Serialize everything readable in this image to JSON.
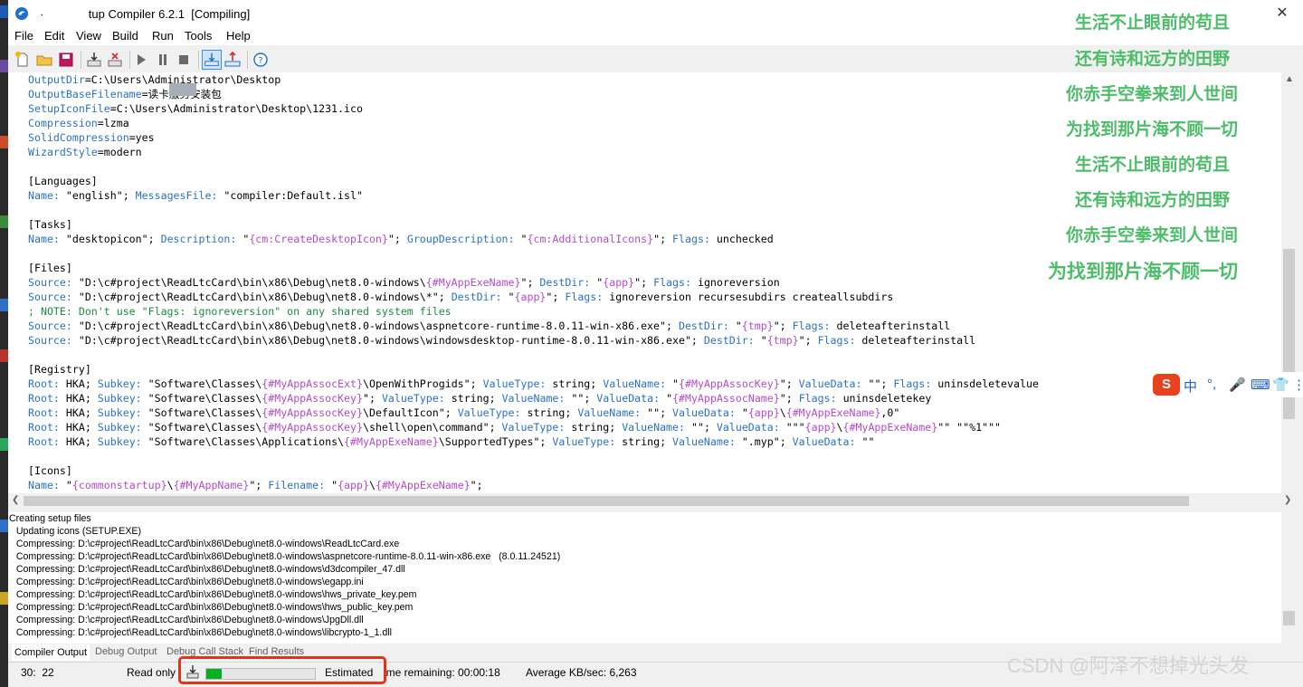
{
  "window": {
    "title": "- Inno Setup Compiler 6.2.1  [Compiling]",
    "close_glyph": "✕"
  },
  "menu": [
    "File",
    "Edit",
    "View",
    "Build",
    "Run",
    "Tools",
    "Help"
  ],
  "editor": {
    "lines": [
      [
        {
          "t": "OutputDir",
          "k": "k"
        },
        {
          "t": "=C:\\Users\\Administrator\\Desktop"
        }
      ],
      [
        {
          "t": "OutputBaseFilename",
          "k": "k"
        },
        {
          "t": "="
        },
        {
          "t": "读卡服务安装包"
        }
      ],
      [
        {
          "t": "SetupIconFile",
          "k": "k"
        },
        {
          "t": "=C:\\Users\\Administrator\\Desktop\\1231.ico"
        }
      ],
      [
        {
          "t": "Compression",
          "k": "k"
        },
        {
          "t": "=lzma"
        }
      ],
      [
        {
          "t": "SolidCompression",
          "k": "k"
        },
        {
          "t": "=yes"
        }
      ],
      [
        {
          "t": "WizardStyle",
          "k": "k"
        },
        {
          "t": "=modern"
        }
      ],
      [],
      [
        {
          "t": "[Languages]"
        }
      ],
      [
        {
          "t": "Name:",
          "k": "k"
        },
        {
          "t": " \"english\"; "
        },
        {
          "t": "MessagesFile:",
          "k": "k"
        },
        {
          "t": " \"compiler:Default.isl\""
        }
      ],
      [],
      [
        {
          "t": "[Tasks]"
        }
      ],
      [
        {
          "t": "Name:",
          "k": "k"
        },
        {
          "t": " \"desktopicon\"; "
        },
        {
          "t": "Description:",
          "k": "k"
        },
        {
          "t": " \""
        },
        {
          "t": "{cm:CreateDesktopIcon}",
          "k": "m"
        },
        {
          "t": "\"; "
        },
        {
          "t": "GroupDescription:",
          "k": "k"
        },
        {
          "t": " \""
        },
        {
          "t": "{cm:AdditionalIcons}",
          "k": "m"
        },
        {
          "t": "\"; "
        },
        {
          "t": "Flags:",
          "k": "k"
        },
        {
          "t": " unchecked"
        }
      ],
      [],
      [
        {
          "t": "[Files]"
        }
      ],
      [
        {
          "t": "Source:",
          "k": "k"
        },
        {
          "t": " \"D:\\c#project\\ReadLtcCard\\bin\\x86\\Debug\\net8.0-windows\\"
        },
        {
          "t": "{#MyAppExeName}",
          "k": "m"
        },
        {
          "t": "\"; "
        },
        {
          "t": "DestDir:",
          "k": "k"
        },
        {
          "t": " \""
        },
        {
          "t": "{app}",
          "k": "m"
        },
        {
          "t": "\"; "
        },
        {
          "t": "Flags:",
          "k": "k"
        },
        {
          "t": " ignoreversion"
        }
      ],
      [
        {
          "t": "Source:",
          "k": "k"
        },
        {
          "t": " \"D:\\c#project\\ReadLtcCard\\bin\\x86\\Debug\\net8.0-windows\\*\"; "
        },
        {
          "t": "DestDir:",
          "k": "k"
        },
        {
          "t": " \""
        },
        {
          "t": "{app}",
          "k": "m"
        },
        {
          "t": "\"; "
        },
        {
          "t": "Flags:",
          "k": "k"
        },
        {
          "t": " ignoreversion recursesubdirs createallsubdirs"
        }
      ],
      [
        {
          "t": "; NOTE: Don't use \"Flags: ignoreversion\" on any shared system files",
          "k": "c"
        }
      ],
      [
        {
          "t": "Source:",
          "k": "k"
        },
        {
          "t": " \"D:\\c#project\\ReadLtcCard\\bin\\x86\\Debug\\net8.0-windows\\aspnetcore-runtime-8.0.11-win-x86.exe\"; "
        },
        {
          "t": "DestDir:",
          "k": "k"
        },
        {
          "t": " \""
        },
        {
          "t": "{tmp}",
          "k": "m"
        },
        {
          "t": "\"; "
        },
        {
          "t": "Flags:",
          "k": "k"
        },
        {
          "t": " deleteafterinstall"
        }
      ],
      [
        {
          "t": "Source:",
          "k": "k"
        },
        {
          "t": " \"D:\\c#project\\ReadLtcCard\\bin\\x86\\Debug\\net8.0-windows\\windowsdesktop-runtime-8.0.11-win-x86.exe\"; "
        },
        {
          "t": "DestDir:",
          "k": "k"
        },
        {
          "t": " \""
        },
        {
          "t": "{tmp}",
          "k": "m"
        },
        {
          "t": "\"; "
        },
        {
          "t": "Flags:",
          "k": "k"
        },
        {
          "t": " deleteafterinstall"
        }
      ],
      [],
      [
        {
          "t": "[Registry]"
        }
      ],
      [
        {
          "t": "Root:",
          "k": "k"
        },
        {
          "t": " HKA; "
        },
        {
          "t": "Subkey:",
          "k": "k"
        },
        {
          "t": " \"Software\\Classes\\"
        },
        {
          "t": "{#MyAppAssocExt}",
          "k": "m"
        },
        {
          "t": "\\OpenWithProgids\"; "
        },
        {
          "t": "ValueType:",
          "k": "k"
        },
        {
          "t": " string; "
        },
        {
          "t": "ValueName:",
          "k": "k"
        },
        {
          "t": " \""
        },
        {
          "t": "{#MyAppAssocKey}",
          "k": "m"
        },
        {
          "t": "\"; "
        },
        {
          "t": "ValueData:",
          "k": "k"
        },
        {
          "t": " \"\"; "
        },
        {
          "t": "Flags:",
          "k": "k"
        },
        {
          "t": " uninsdeletevalue"
        }
      ],
      [
        {
          "t": "Root:",
          "k": "k"
        },
        {
          "t": " HKA; "
        },
        {
          "t": "Subkey:",
          "k": "k"
        },
        {
          "t": " \"Software\\Classes\\"
        },
        {
          "t": "{#MyAppAssocKey}",
          "k": "m"
        },
        {
          "t": "\"; "
        },
        {
          "t": "ValueType:",
          "k": "k"
        },
        {
          "t": " string; "
        },
        {
          "t": "ValueName:",
          "k": "k"
        },
        {
          "t": " \"\"; "
        },
        {
          "t": "ValueData:",
          "k": "k"
        },
        {
          "t": " \""
        },
        {
          "t": "{#MyAppAssocName}",
          "k": "m"
        },
        {
          "t": "\"; "
        },
        {
          "t": "Flags:",
          "k": "k"
        },
        {
          "t": " uninsdeletekey"
        }
      ],
      [
        {
          "t": "Root:",
          "k": "k"
        },
        {
          "t": " HKA; "
        },
        {
          "t": "Subkey:",
          "k": "k"
        },
        {
          "t": " \"Software\\Classes\\"
        },
        {
          "t": "{#MyAppAssocKey}",
          "k": "m"
        },
        {
          "t": "\\DefaultIcon\"; "
        },
        {
          "t": "ValueType:",
          "k": "k"
        },
        {
          "t": " string; "
        },
        {
          "t": "ValueName:",
          "k": "k"
        },
        {
          "t": " \"\"; "
        },
        {
          "t": "ValueData:",
          "k": "k"
        },
        {
          "t": " \""
        },
        {
          "t": "{app}",
          "k": "m"
        },
        {
          "t": "\\"
        },
        {
          "t": "{#MyAppExeName}",
          "k": "m"
        },
        {
          "t": ",0\""
        }
      ],
      [
        {
          "t": "Root:",
          "k": "k"
        },
        {
          "t": " HKA; "
        },
        {
          "t": "Subkey:",
          "k": "k"
        },
        {
          "t": " \"Software\\Classes\\"
        },
        {
          "t": "{#MyAppAssocKey}",
          "k": "m"
        },
        {
          "t": "\\shell\\open\\command\"; "
        },
        {
          "t": "ValueType:",
          "k": "k"
        },
        {
          "t": " string; "
        },
        {
          "t": "ValueName:",
          "k": "k"
        },
        {
          "t": " \"\"; "
        },
        {
          "t": "ValueData:",
          "k": "k"
        },
        {
          "t": " \"\"\""
        },
        {
          "t": "{app}",
          "k": "m"
        },
        {
          "t": "\\"
        },
        {
          "t": "{#MyAppExeName}",
          "k": "m"
        },
        {
          "t": "\"\" \"\"%1\"\"\""
        }
      ],
      [
        {
          "t": "Root:",
          "k": "k"
        },
        {
          "t": " HKA; "
        },
        {
          "t": "Subkey:",
          "k": "k"
        },
        {
          "t": " \"Software\\Classes\\Applications\\"
        },
        {
          "t": "{#MyAppExeName}",
          "k": "m"
        },
        {
          "t": "\\SupportedTypes\"; "
        },
        {
          "t": "ValueType:",
          "k": "k"
        },
        {
          "t": " string; "
        },
        {
          "t": "ValueName:",
          "k": "k"
        },
        {
          "t": " \".myp\"; "
        },
        {
          "t": "ValueData:",
          "k": "k"
        },
        {
          "t": " \"\""
        }
      ],
      [],
      [
        {
          "t": "[Icons]"
        }
      ],
      [
        {
          "t": "Name:",
          "k": "k"
        },
        {
          "t": " \""
        },
        {
          "t": "{commonstartup}",
          "k": "m"
        },
        {
          "t": "\\"
        },
        {
          "t": "{#MyAppName}",
          "k": "m"
        },
        {
          "t": "\"; "
        },
        {
          "t": "Filename:",
          "k": "k"
        },
        {
          "t": " \""
        },
        {
          "t": "{app}",
          "k": "m"
        },
        {
          "t": "\\"
        },
        {
          "t": "{#MyAppExeName}",
          "k": "m"
        },
        {
          "t": "\";"
        }
      ]
    ]
  },
  "output": {
    "lines": [
      "Creating setup files",
      "   Updating icons (SETUP.EXE)",
      "   Compressing: D:\\c#project\\ReadLtcCard\\bin\\x86\\Debug\\net8.0-windows\\ReadLtcCard.exe",
      "   Compressing: D:\\c#project\\ReadLtcCard\\bin\\x86\\Debug\\net8.0-windows\\aspnetcore-runtime-8.0.11-win-x86.exe   (8.0.11.24521)",
      "   Compressing: D:\\c#project\\ReadLtcCard\\bin\\x86\\Debug\\net8.0-windows\\d3dcompiler_47.dll",
      "   Compressing: D:\\c#project\\ReadLtcCard\\bin\\x86\\Debug\\net8.0-windows\\egapp.ini",
      "   Compressing: D:\\c#project\\ReadLtcCard\\bin\\x86\\Debug\\net8.0-windows\\hws_private_key.pem",
      "   Compressing: D:\\c#project\\ReadLtcCard\\bin\\x86\\Debug\\net8.0-windows\\hws_public_key.pem",
      "   Compressing: D:\\c#project\\ReadLtcCard\\bin\\x86\\Debug\\net8.0-windows\\JpgDll.dll",
      "   Compressing: D:\\c#project\\ReadLtcCard\\bin\\x86\\Debug\\net8.0-windows\\libcrypto-1_1.dll"
    ]
  },
  "tabs": [
    "Compiler Output",
    "Debug Output",
    "Debug Call Stack",
    "Find Results"
  ],
  "status": {
    "position": "30:  22",
    "mode": "Read only",
    "progress": 0.14,
    "estimated": "Estimated",
    "remaining": "ime remaining: 00:00:18",
    "speed": "Average KB/sec: 6,263"
  },
  "overlay": {
    "poem_lines": [
      "生活不止眼前的苟且",
      "还有诗和远方的田野",
      "你赤手空拳来到人世间",
      "为找到那片海不顾一切",
      "生活不止眼前的苟且",
      "还有诗和远方的田野",
      "你赤手空拳来到人世间",
      "为找到那片海不顾一切"
    ],
    "ime_items": [
      "S",
      "中",
      "°,",
      "🎤",
      "⌨",
      "👕",
      "⋮"
    ],
    "watermark": "CSDN @阿泽不想掉光头发"
  },
  "colors": {
    "keyword": "#2b71c4",
    "comment": "#1e8a3e",
    "macro": "#b24cc8",
    "progress": "#06b025",
    "highlight": "#e4331b",
    "poem": "#4dbd6a"
  }
}
